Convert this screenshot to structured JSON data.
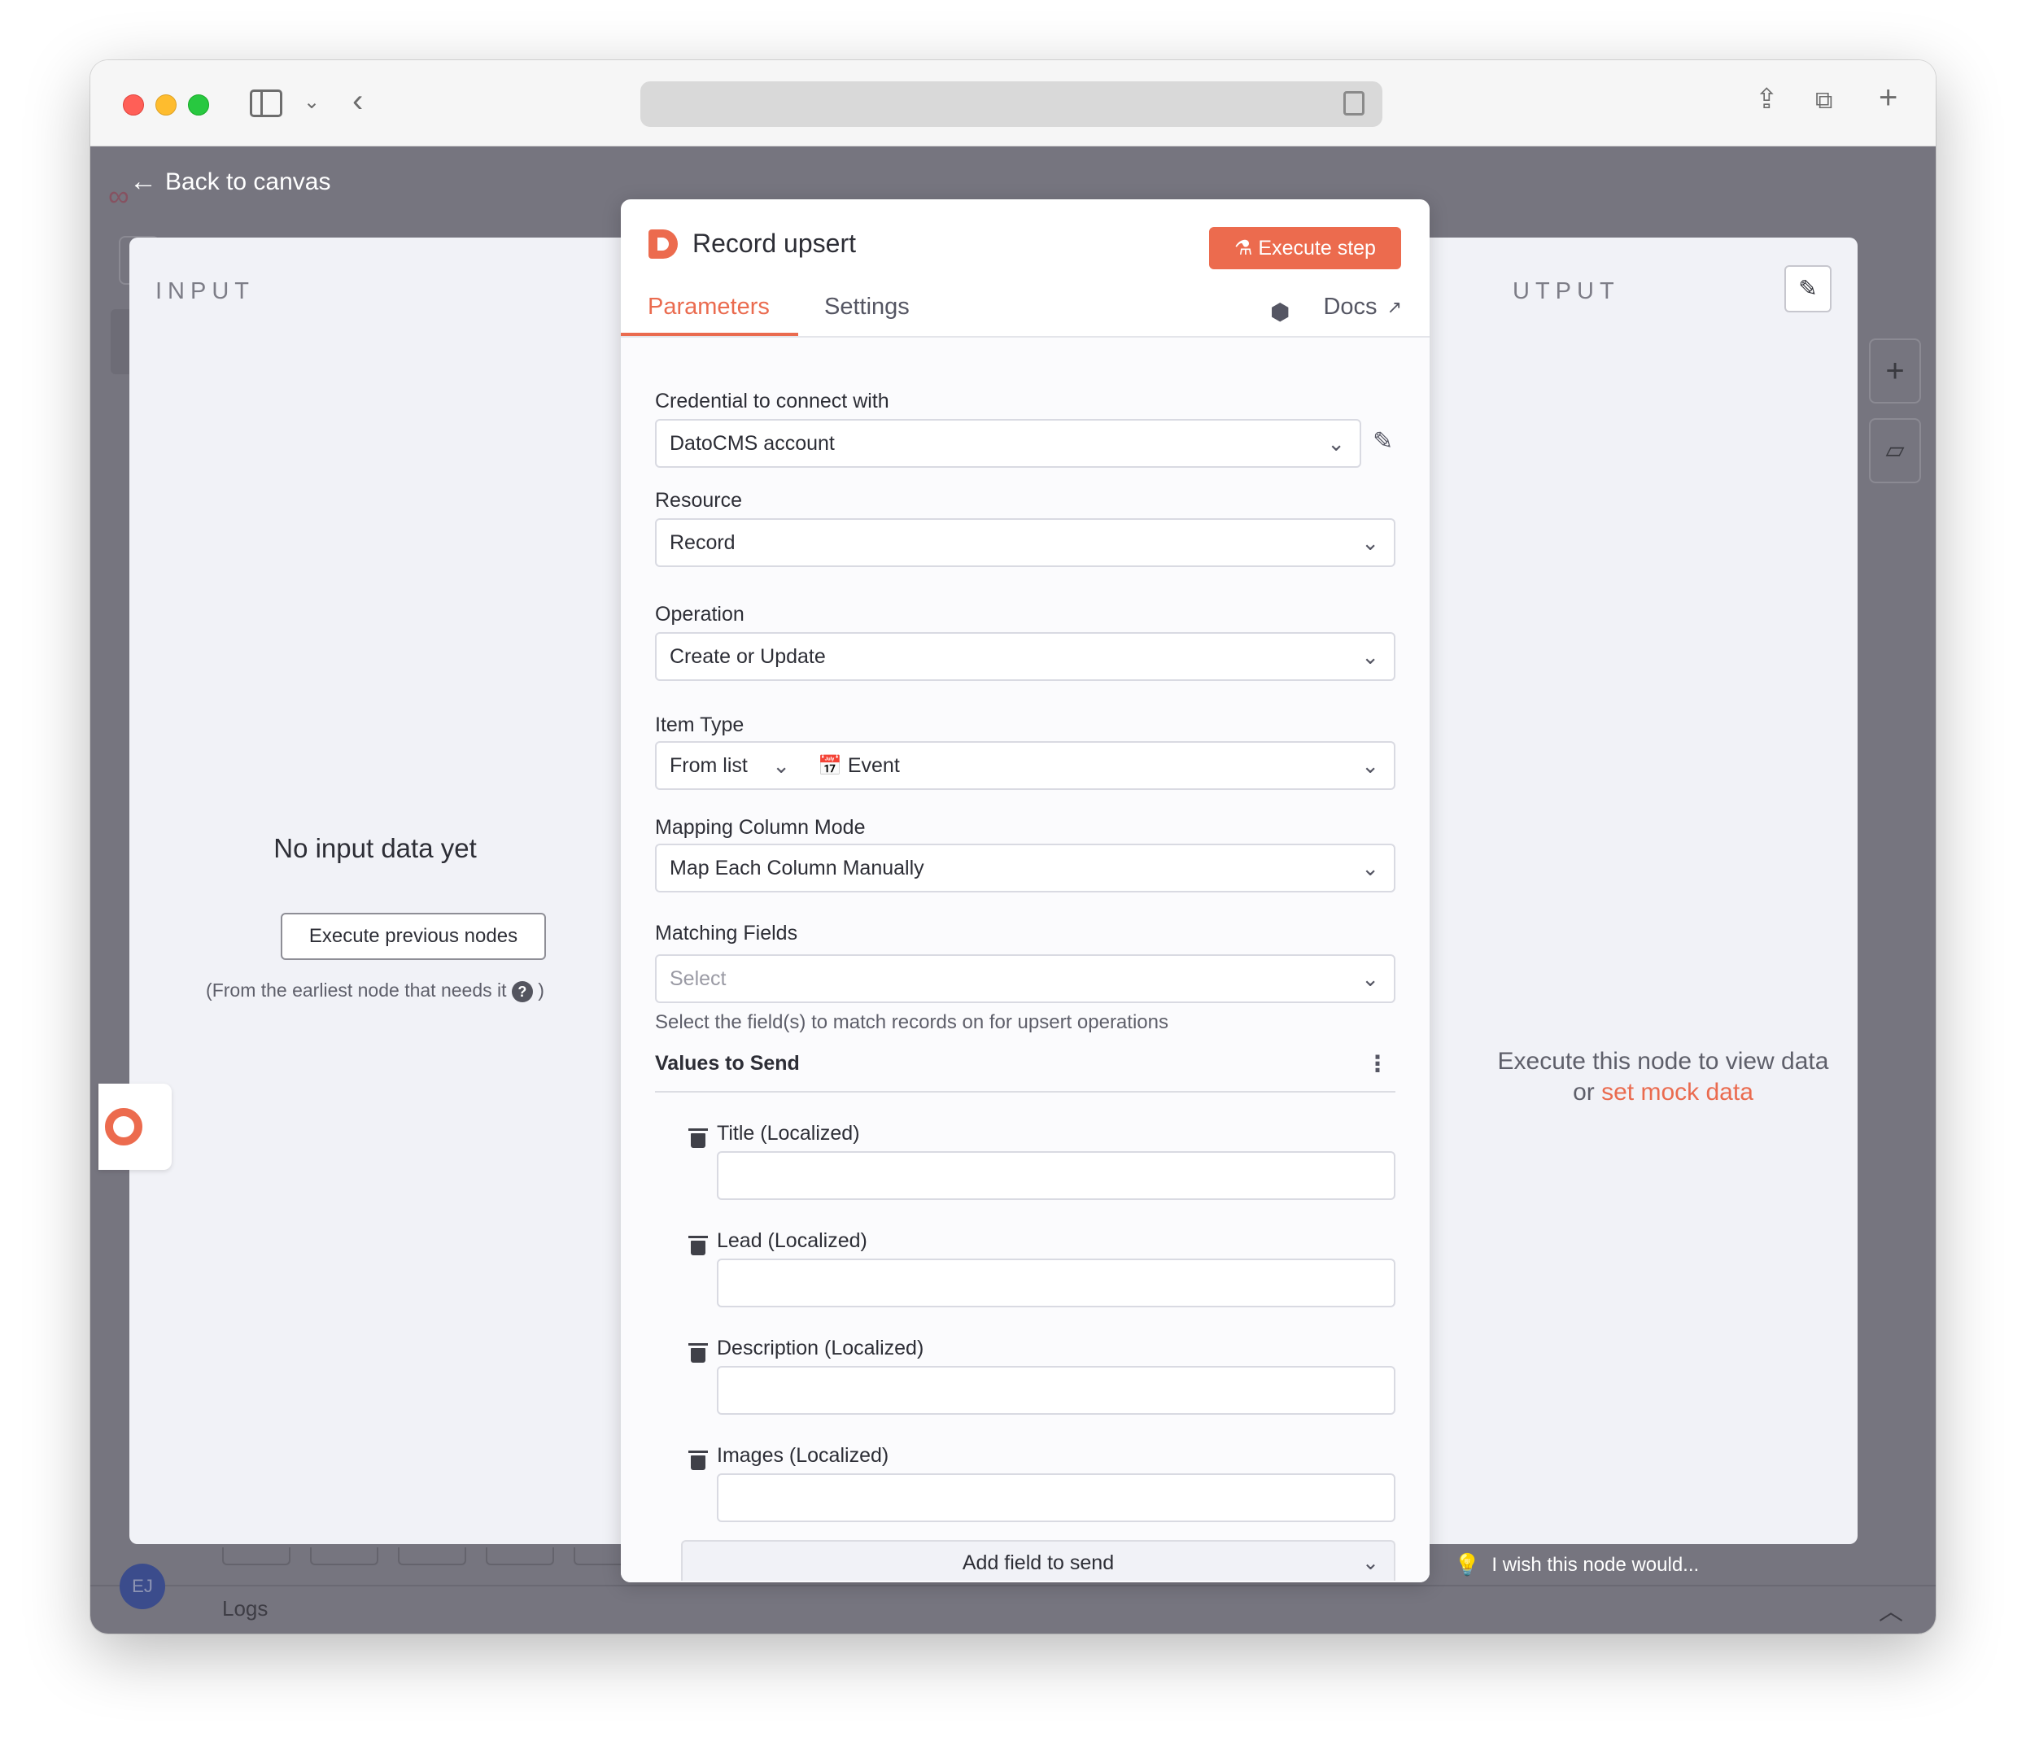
{
  "browser": {
    "url": ""
  },
  "canvas": {
    "back_label": "Back to canvas",
    "logs_label": "Logs",
    "avatar_initials": "EJ",
    "feedback_label": "I wish this node would..."
  },
  "input_panel": {
    "label": "INPUT",
    "empty_title": "No input data yet",
    "execute_previous_label": "Execute previous nodes",
    "hint_before": "(From the earliest node that needs it",
    "hint_after": ")",
    "help_glyph": "?"
  },
  "output_panel": {
    "label": "OUTPUT",
    "label_visible": "UTPUT",
    "message_line1": "Execute this node to view data",
    "message_or": "or",
    "mock_link": "set mock data"
  },
  "node": {
    "title": "Record upsert",
    "execute_step_label": "Execute step",
    "tabs": {
      "parameters": "Parameters",
      "settings": "Settings",
      "docs": "Docs"
    }
  },
  "params": {
    "credential": {
      "label": "Credential to connect with",
      "value": "DatoCMS account"
    },
    "resource": {
      "label": "Resource",
      "value": "Record"
    },
    "operation": {
      "label": "Operation",
      "value": "Create or Update"
    },
    "item_type": {
      "label": "Item Type",
      "mode": "From list",
      "value": "Event",
      "value_icon": "calendar-icon"
    },
    "mapping_mode": {
      "label": "Mapping Column Mode",
      "value": "Map Each Column Manually"
    },
    "matching_fields": {
      "label": "Matching Fields",
      "placeholder": "Select",
      "hint": "Select the field(s) to match records on for upsert operations"
    },
    "values_to_send": {
      "label": "Values to Send",
      "fields": [
        {
          "label": "Title (Localized)",
          "value": ""
        },
        {
          "label": "Lead (Localized)",
          "value": ""
        },
        {
          "label": "Description (Localized)",
          "value": ""
        },
        {
          "label": "Images (Localized)",
          "value": ""
        }
      ],
      "add_field_label": "Add field to send"
    }
  },
  "colors": {
    "accent": "#ea6b4f",
    "canvas_bg": "#76757f",
    "panel_bg": "#f1f2f7"
  }
}
